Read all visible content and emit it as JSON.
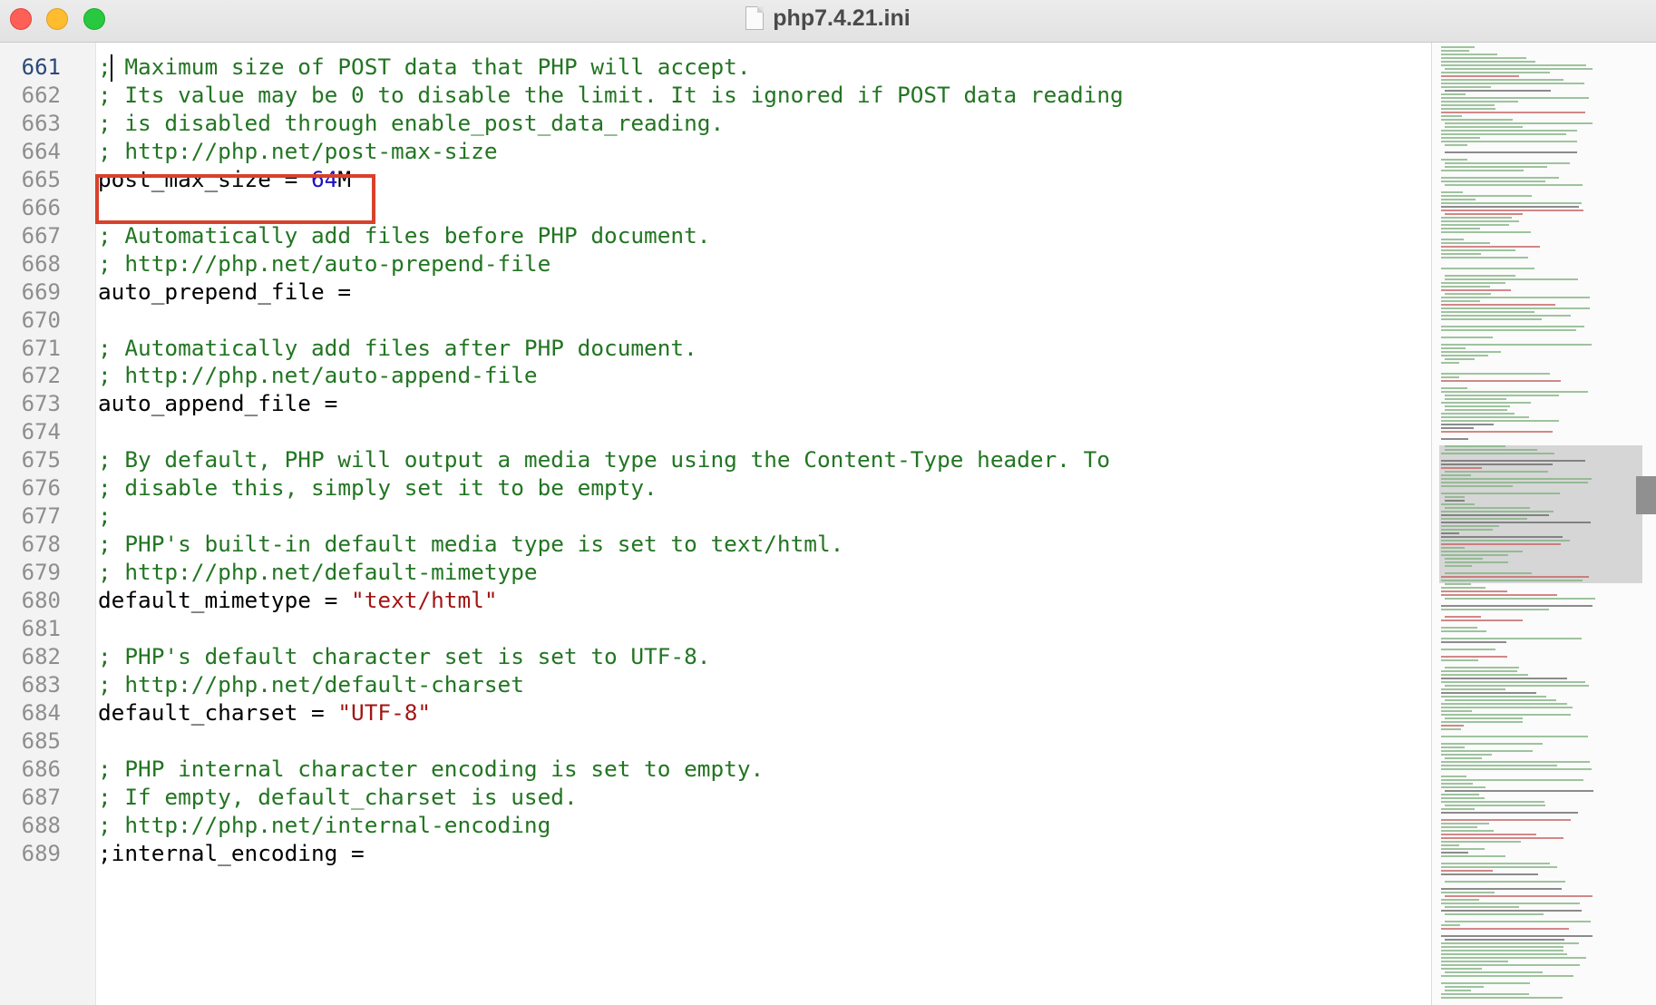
{
  "window": {
    "title": "php7.4.21.ini",
    "icons": [
      "close-light",
      "minimize-light",
      "zoom-light",
      "document-icon"
    ]
  },
  "editor": {
    "current_line": "661",
    "lines": [
      {
        "n": "661",
        "text": "; Maximum size of POST data that PHP will accept.",
        "kind": "comment"
      },
      {
        "n": "662",
        "text": "; Its value may be 0 to disable the limit. It is ignored if POST data reading",
        "kind": "comment"
      },
      {
        "n": "663",
        "text": "; is disabled through enable_post_data_reading.",
        "kind": "comment"
      },
      {
        "n": "664",
        "text": "; http://php.net/post-max-size",
        "kind": "comment"
      },
      {
        "n": "665",
        "key": "post_max_size = ",
        "value_num": "64",
        "value_rest": "M",
        "kind": "setting-num"
      },
      {
        "n": "666",
        "text": "",
        "kind": "blank"
      },
      {
        "n": "667",
        "text": "; Automatically add files before PHP document.",
        "kind": "comment"
      },
      {
        "n": "668",
        "text": "; http://php.net/auto-prepend-file",
        "kind": "comment"
      },
      {
        "n": "669",
        "text": "auto_prepend_file =",
        "kind": "setting"
      },
      {
        "n": "670",
        "text": "",
        "kind": "blank"
      },
      {
        "n": "671",
        "text": "; Automatically add files after PHP document.",
        "kind": "comment"
      },
      {
        "n": "672",
        "text": "; http://php.net/auto-append-file",
        "kind": "comment"
      },
      {
        "n": "673",
        "text": "auto_append_file =",
        "kind": "setting"
      },
      {
        "n": "674",
        "text": "",
        "kind": "blank"
      },
      {
        "n": "675",
        "text": "; By default, PHP will output a media type using the Content-Type header. To",
        "kind": "comment"
      },
      {
        "n": "676",
        "text": "; disable this, simply set it to be empty.",
        "kind": "comment"
      },
      {
        "n": "677",
        "text": ";",
        "kind": "comment"
      },
      {
        "n": "678",
        "text": "; PHP's built-in default media type is set to text/html.",
        "kind": "comment"
      },
      {
        "n": "679",
        "text": "; http://php.net/default-mimetype",
        "kind": "comment"
      },
      {
        "n": "680",
        "key": "default_mimetype = ",
        "value_str": "\"text/html\"",
        "kind": "setting-str"
      },
      {
        "n": "681",
        "text": "",
        "kind": "blank"
      },
      {
        "n": "682",
        "text": "; PHP's default character set is set to UTF-8.",
        "kind": "comment"
      },
      {
        "n": "683",
        "text": "; http://php.net/default-charset",
        "kind": "comment"
      },
      {
        "n": "684",
        "key": "default_charset = ",
        "value_str": "\"UTF-8\"",
        "kind": "setting-str"
      },
      {
        "n": "685",
        "text": "",
        "kind": "blank"
      },
      {
        "n": "686",
        "text": "; PHP internal character encoding is set to empty.",
        "kind": "comment"
      },
      {
        "n": "687",
        "text": "; If empty, default_charset is used.",
        "kind": "comment"
      },
      {
        "n": "688",
        "text": "; http://php.net/internal-encoding",
        "kind": "comment"
      },
      {
        "n": "689",
        "text": ";internal_encoding =",
        "kind": "setting"
      }
    ]
  },
  "colors": {
    "comment": "#227522",
    "string": "#a31515",
    "number": "#1c10c2",
    "highlight": "#d9412c"
  }
}
